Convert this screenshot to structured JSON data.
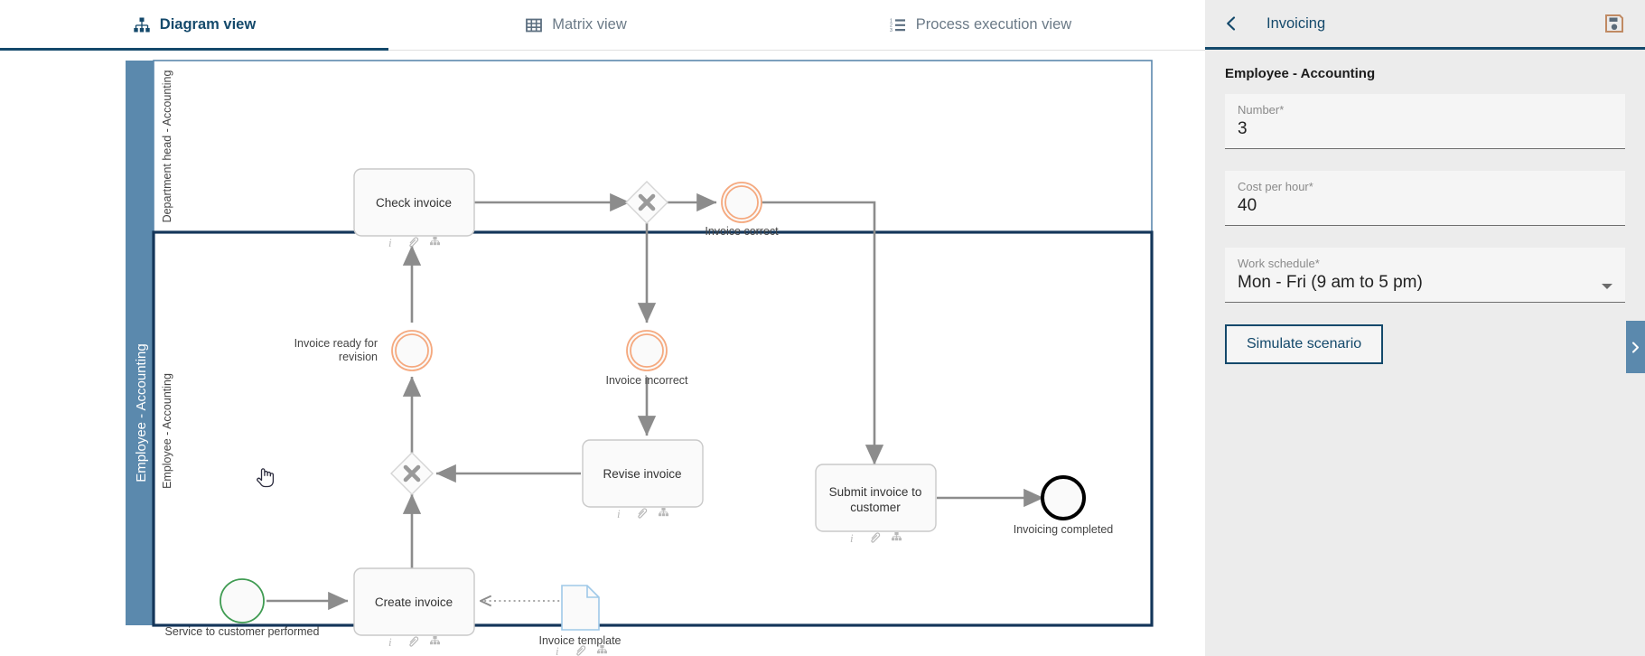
{
  "tabs": [
    {
      "label": "Diagram view",
      "icon": "org-chart-icon",
      "active": true
    },
    {
      "label": "Matrix view",
      "icon": "grid-icon",
      "active": false
    },
    {
      "label": "Process execution view",
      "icon": "numbered-list-icon",
      "active": false
    }
  ],
  "panel": {
    "title": "Invoicing",
    "back_icon": "chevron-left-icon",
    "save_icon": "save-floppy-icon",
    "section_title": "Employee - Accounting",
    "fields": [
      {
        "label": "Number*",
        "value": "3",
        "type": "text"
      },
      {
        "label": "Cost per hour*",
        "value": "40",
        "type": "text"
      },
      {
        "label": "Work schedule*",
        "value": "Mon - Fri (9 am to 5 pm)",
        "type": "select"
      }
    ],
    "simulate_button": "Simulate scenario",
    "collapse_handle_icon": "chevron-right-icon"
  },
  "diagram": {
    "pool_label": "Employee - Accounting",
    "lanes": [
      {
        "label": "Department head - Accounting",
        "selected": false
      },
      {
        "label": "Employee - Accounting",
        "selected": true
      }
    ],
    "nodes": [
      {
        "id": "check-invoice",
        "type": "task",
        "label": "Check invoice",
        "markers": [
          "info-icon",
          "attachment-icon",
          "org-chart-icon"
        ]
      },
      {
        "id": "gw-check",
        "type": "gateway-exclusive",
        "label": ""
      },
      {
        "id": "invoice-correct",
        "type": "intermediate-event",
        "label": "Invoice correct",
        "color": "#f5a97f"
      },
      {
        "id": "invoice-ready-for-revision",
        "type": "intermediate-event",
        "label": "Invoice ready for revision",
        "color": "#f5a97f"
      },
      {
        "id": "invoice-incorrect",
        "type": "intermediate-event",
        "label": "Invoice incorrect",
        "color": "#f5a97f"
      },
      {
        "id": "revise-invoice",
        "type": "task",
        "label": "Revise invoice",
        "markers": [
          "info-icon",
          "attachment-icon",
          "org-chart-icon"
        ]
      },
      {
        "id": "gw-merge",
        "type": "gateway-exclusive",
        "label": ""
      },
      {
        "id": "create-invoice",
        "type": "task",
        "label": "Create invoice",
        "markers": [
          "info-icon",
          "attachment-icon",
          "org-chart-icon"
        ]
      },
      {
        "id": "service-performed",
        "type": "start-event",
        "label": "Service to customer performed",
        "color": "#3f9b52"
      },
      {
        "id": "invoice-template",
        "type": "data-object",
        "label": "Invoice template",
        "markers": [
          "info-icon",
          "attachment-icon",
          "org-chart-icon"
        ]
      },
      {
        "id": "submit-invoice",
        "type": "task",
        "label": "Submit invoice to customer",
        "markers": [
          "info-icon",
          "attachment-icon",
          "org-chart-icon"
        ]
      },
      {
        "id": "invoicing-completed",
        "type": "end-event",
        "label": "Invoicing completed",
        "color": "#000000"
      }
    ]
  },
  "colors": {
    "accent": "#14496b",
    "pool_bar": "#5b89ad",
    "event_orange": "#f5a97f",
    "start_green": "#3f9b52",
    "edge_gray": "#8c8c8c"
  }
}
